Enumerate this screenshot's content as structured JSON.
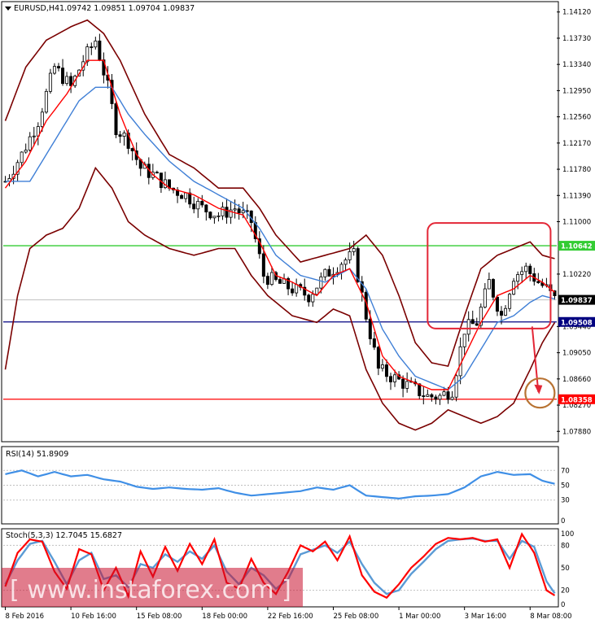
{
  "header": {
    "symbol": "EURUSD,H4",
    "ohlc": "1.09742 1.09851 1.09704 1.09837"
  },
  "watermark": {
    "text": "[ www.instaforex.com ]"
  },
  "colors": {
    "candles": "#000000",
    "bb": "#7a0000",
    "ma_fast": "#ff0000",
    "ma_slow": "#3f7fd6",
    "level_green": "#33cc33",
    "level_navy": "#000080",
    "level_red": "#ff0000",
    "rsi": "#3f8fe6",
    "stoch_main": "#ff0000",
    "stoch_signal": "#5b9bd5",
    "target_circle": "#b87333"
  },
  "chart_data": [
    {
      "type": "line",
      "panel": "price",
      "y_ticks": [
        "1.14120",
        "1.13730",
        "1.13340",
        "1.12950",
        "1.12560",
        "1.12170",
        "1.11780",
        "1.11390",
        "1.11000",
        "1.10220",
        "1.09440",
        "1.09050",
        "1.08660",
        "1.08270",
        "1.07880"
      ],
      "ylim": [
        1.0775,
        1.1425
      ],
      "x_ticks": [
        "8 Feb 2016",
        "10 Feb 16:00",
        "15 Feb 08:00",
        "18 Feb 00:00",
        "22 Feb 16:00",
        "25 Feb 08:00",
        "1 Mar 00:00",
        "3 Mar 16:00",
        "8 Mar 08:00"
      ],
      "x_count": 135,
      "x_tick_bars": [
        0,
        16,
        32,
        48,
        64,
        80,
        96,
        112,
        128
      ],
      "levels": [
        {
          "value": 1.10642,
          "label": "1.10642",
          "color": "#33cc33"
        },
        {
          "value": 1.09508,
          "label": "1.09508",
          "color": "#000080"
        },
        {
          "value": 1.08358,
          "label": "1.08358",
          "color": "#ff0000"
        }
      ],
      "current_price": {
        "value": 1.09837,
        "label": "1.09837"
      },
      "close_anchors": [
        [
          0,
          1.116
        ],
        [
          4,
          1.12
        ],
        [
          8,
          1.125
        ],
        [
          12,
          1.133
        ],
        [
          16,
          1.13
        ],
        [
          19,
          1.134
        ],
        [
          22,
          1.137
        ],
        [
          25,
          1.13
        ],
        [
          27,
          1.124
        ],
        [
          30,
          1.122
        ],
        [
          33,
          1.118
        ],
        [
          36,
          1.117
        ],
        [
          40,
          1.115
        ],
        [
          44,
          1.114
        ],
        [
          48,
          1.112
        ],
        [
          52,
          1.111
        ],
        [
          56,
          1.112
        ],
        [
          60,
          1.11
        ],
        [
          63,
          1.102
        ],
        [
          66,
          1.101
        ],
        [
          70,
          1.1
        ],
        [
          74,
          1.099
        ],
        [
          78,
          1.102
        ],
        [
          82,
          1.104
        ],
        [
          85,
          1.105
        ],
        [
          88,
          1.096
        ],
        [
          91,
          1.088
        ],
        [
          94,
          1.087
        ],
        [
          97,
          1.086
        ],
        [
          100,
          1.085
        ],
        [
          103,
          1.084
        ],
        [
          106,
          1.084
        ],
        [
          109,
          1.085
        ],
        [
          112,
          1.094
        ],
        [
          115,
          1.095
        ],
        [
          118,
          1.101
        ],
        [
          121,
          1.096
        ],
        [
          124,
          1.102
        ],
        [
          127,
          1.103
        ],
        [
          130,
          1.101
        ],
        [
          132,
          1.1
        ],
        [
          134,
          1.0984
        ]
      ],
      "wicks": {
        "spread": 0.0016,
        "seed": 7
      },
      "bollinger": {
        "upper": [
          [
            0,
            1.125
          ],
          [
            5,
            1.133
          ],
          [
            10,
            1.137
          ],
          [
            16,
            1.139
          ],
          [
            20,
            1.14
          ],
          [
            24,
            1.138
          ],
          [
            28,
            1.134
          ],
          [
            34,
            1.126
          ],
          [
            40,
            1.12
          ],
          [
            46,
            1.118
          ],
          [
            52,
            1.115
          ],
          [
            58,
            1.115
          ],
          [
            62,
            1.112
          ],
          [
            66,
            1.108
          ],
          [
            72,
            1.104
          ],
          [
            78,
            1.105
          ],
          [
            84,
            1.106
          ],
          [
            88,
            1.108
          ],
          [
            92,
            1.105
          ],
          [
            96,
            1.099
          ],
          [
            100,
            1.092
          ],
          [
            104,
            1.089
          ],
          [
            108,
            1.0885
          ],
          [
            112,
            1.096
          ],
          [
            116,
            1.103
          ],
          [
            120,
            1.105
          ],
          [
            124,
            1.106
          ],
          [
            128,
            1.107
          ],
          [
            131,
            1.105
          ],
          [
            134,
            1.1045
          ]
        ],
        "lower": [
          [
            0,
            1.088
          ],
          [
            3,
            1.099
          ],
          [
            6,
            1.106
          ],
          [
            10,
            1.108
          ],
          [
            14,
            1.109
          ],
          [
            18,
            1.112
          ],
          [
            22,
            1.118
          ],
          [
            26,
            1.115
          ],
          [
            30,
            1.11
          ],
          [
            34,
            1.108
          ],
          [
            40,
            1.106
          ],
          [
            46,
            1.105
          ],
          [
            52,
            1.106
          ],
          [
            56,
            1.106
          ],
          [
            60,
            1.102
          ],
          [
            64,
            1.099
          ],
          [
            70,
            1.096
          ],
          [
            76,
            1.095
          ],
          [
            80,
            1.097
          ],
          [
            84,
            1.096
          ],
          [
            88,
            1.088
          ],
          [
            92,
            1.083
          ],
          [
            96,
            1.08
          ],
          [
            100,
            1.079
          ],
          [
            104,
            1.08
          ],
          [
            108,
            1.082
          ],
          [
            112,
            1.081
          ],
          [
            116,
            1.08
          ],
          [
            120,
            1.081
          ],
          [
            124,
            1.083
          ],
          [
            128,
            1.088
          ],
          [
            131,
            1.092
          ],
          [
            134,
            1.095
          ]
        ]
      },
      "ma_fast": [
        [
          0,
          1.115
        ],
        [
          5,
          1.119
        ],
        [
          10,
          1.125
        ],
        [
          15,
          1.129
        ],
        [
          20,
          1.134
        ],
        [
          24,
          1.134
        ],
        [
          28,
          1.126
        ],
        [
          32,
          1.12
        ],
        [
          36,
          1.117
        ],
        [
          40,
          1.115
        ],
        [
          46,
          1.114
        ],
        [
          52,
          1.112
        ],
        [
          58,
          1.111
        ],
        [
          62,
          1.107
        ],
        [
          66,
          1.102
        ],
        [
          70,
          1.101
        ],
        [
          76,
          1.099
        ],
        [
          80,
          1.102
        ],
        [
          84,
          1.103
        ],
        [
          88,
          1.098
        ],
        [
          92,
          1.09
        ],
        [
          96,
          1.087
        ],
        [
          100,
          1.086
        ],
        [
          104,
          1.085
        ],
        [
          108,
          1.085
        ],
        [
          112,
          1.09
        ],
        [
          116,
          1.095
        ],
        [
          120,
          1.099
        ],
        [
          124,
          1.1
        ],
        [
          128,
          1.102
        ],
        [
          131,
          1.101
        ],
        [
          134,
          1.0995
        ]
      ],
      "ma_slow": [
        [
          0,
          1.116
        ],
        [
          6,
          1.116
        ],
        [
          10,
          1.12
        ],
        [
          14,
          1.124
        ],
        [
          18,
          1.128
        ],
        [
          22,
          1.13
        ],
        [
          26,
          1.13
        ],
        [
          30,
          1.126
        ],
        [
          34,
          1.123
        ],
        [
          40,
          1.119
        ],
        [
          46,
          1.116
        ],
        [
          52,
          1.114
        ],
        [
          58,
          1.112
        ],
        [
          62,
          1.109
        ],
        [
          66,
          1.105
        ],
        [
          72,
          1.102
        ],
        [
          78,
          1.101
        ],
        [
          84,
          1.103
        ],
        [
          88,
          1.1
        ],
        [
          92,
          1.094
        ],
        [
          96,
          1.09
        ],
        [
          100,
          1.087
        ],
        [
          104,
          1.086
        ],
        [
          108,
          1.085
        ],
        [
          112,
          1.087
        ],
        [
          116,
          1.091
        ],
        [
          120,
          1.095
        ],
        [
          124,
          1.096
        ],
        [
          128,
          1.098
        ],
        [
          131,
          1.099
        ],
        [
          134,
          1.0985
        ]
      ],
      "annotations": [
        {
          "type": "rect",
          "x1": 1.1,
          "x2": 1.103,
          "note": ""
        }
      ],
      "forecast": {
        "from": [
          128,
          1.0944
        ],
        "to": [
          131,
          1.0837
        ]
      }
    },
    {
      "type": "line",
      "panel": "rsi",
      "title": "RSI(14) 51.8909",
      "y_ticks": [
        "70",
        "50",
        "30",
        "0"
      ],
      "ylim": [
        0,
        100
      ],
      "values": [
        [
          0,
          65
        ],
        [
          4,
          70
        ],
        [
          8,
          62
        ],
        [
          12,
          68
        ],
        [
          16,
          62
        ],
        [
          20,
          64
        ],
        [
          24,
          58
        ],
        [
          28,
          55
        ],
        [
          32,
          48
        ],
        [
          36,
          45
        ],
        [
          40,
          47
        ],
        [
          44,
          45
        ],
        [
          48,
          44
        ],
        [
          52,
          46
        ],
        [
          56,
          40
        ],
        [
          60,
          36
        ],
        [
          64,
          38
        ],
        [
          68,
          40
        ],
        [
          72,
          42
        ],
        [
          76,
          47
        ],
        [
          80,
          44
        ],
        [
          84,
          50
        ],
        [
          88,
          36
        ],
        [
          92,
          34
        ],
        [
          96,
          32
        ],
        [
          100,
          35
        ],
        [
          104,
          36
        ],
        [
          108,
          38
        ],
        [
          112,
          47
        ],
        [
          116,
          62
        ],
        [
          120,
          68
        ],
        [
          124,
          64
        ],
        [
          128,
          65
        ],
        [
          131,
          56
        ],
        [
          134,
          52
        ]
      ]
    },
    {
      "type": "line",
      "panel": "stoch",
      "title": "Stoch(5,3,3) 12.7045 15.6827",
      "y_ticks": [
        "100",
        "80",
        "50",
        "20",
        "0"
      ],
      "ylim": [
        0,
        100
      ],
      "main": [
        [
          0,
          25
        ],
        [
          3,
          70
        ],
        [
          6,
          88
        ],
        [
          9,
          85
        ],
        [
          12,
          45
        ],
        [
          15,
          22
        ],
        [
          18,
          75
        ],
        [
          21,
          68
        ],
        [
          24,
          20
        ],
        [
          27,
          50
        ],
        [
          30,
          12
        ],
        [
          33,
          72
        ],
        [
          36,
          38
        ],
        [
          39,
          78
        ],
        [
          42,
          46
        ],
        [
          45,
          82
        ],
        [
          48,
          55
        ],
        [
          51,
          88
        ],
        [
          54,
          30
        ],
        [
          57,
          22
        ],
        [
          60,
          62
        ],
        [
          63,
          30
        ],
        [
          66,
          15
        ],
        [
          69,
          45
        ],
        [
          72,
          80
        ],
        [
          75,
          72
        ],
        [
          78,
          85
        ],
        [
          81,
          60
        ],
        [
          84,
          92
        ],
        [
          87,
          40
        ],
        [
          90,
          18
        ],
        [
          93,
          10
        ],
        [
          96,
          28
        ],
        [
          99,
          50
        ],
        [
          102,
          65
        ],
        [
          105,
          82
        ],
        [
          108,
          90
        ],
        [
          111,
          88
        ],
        [
          114,
          90
        ],
        [
          117,
          85
        ],
        [
          120,
          88
        ],
        [
          123,
          50
        ],
        [
          126,
          95
        ],
        [
          129,
          70
        ],
        [
          132,
          20
        ],
        [
          134,
          13
        ]
      ],
      "signal": [
        [
          0,
          28
        ],
        [
          3,
          60
        ],
        [
          6,
          82
        ],
        [
          9,
          86
        ],
        [
          12,
          58
        ],
        [
          15,
          28
        ],
        [
          18,
          60
        ],
        [
          21,
          70
        ],
        [
          24,
          35
        ],
        [
          27,
          40
        ],
        [
          30,
          24
        ],
        [
          33,
          55
        ],
        [
          36,
          50
        ],
        [
          39,
          68
        ],
        [
          42,
          58
        ],
        [
          45,
          72
        ],
        [
          48,
          62
        ],
        [
          51,
          80
        ],
        [
          54,
          45
        ],
        [
          57,
          28
        ],
        [
          60,
          50
        ],
        [
          63,
          40
        ],
        [
          66,
          22
        ],
        [
          69,
          35
        ],
        [
          72,
          68
        ],
        [
          75,
          74
        ],
        [
          78,
          80
        ],
        [
          81,
          70
        ],
        [
          84,
          85
        ],
        [
          87,
          55
        ],
        [
          90,
          30
        ],
        [
          93,
          15
        ],
        [
          96,
          20
        ],
        [
          99,
          42
        ],
        [
          102,
          58
        ],
        [
          105,
          75
        ],
        [
          108,
          86
        ],
        [
          111,
          88
        ],
        [
          114,
          89
        ],
        [
          117,
          86
        ],
        [
          120,
          86
        ],
        [
          123,
          62
        ],
        [
          126,
          86
        ],
        [
          129,
          78
        ],
        [
          132,
          32
        ],
        [
          134,
          16
        ]
      ]
    }
  ]
}
